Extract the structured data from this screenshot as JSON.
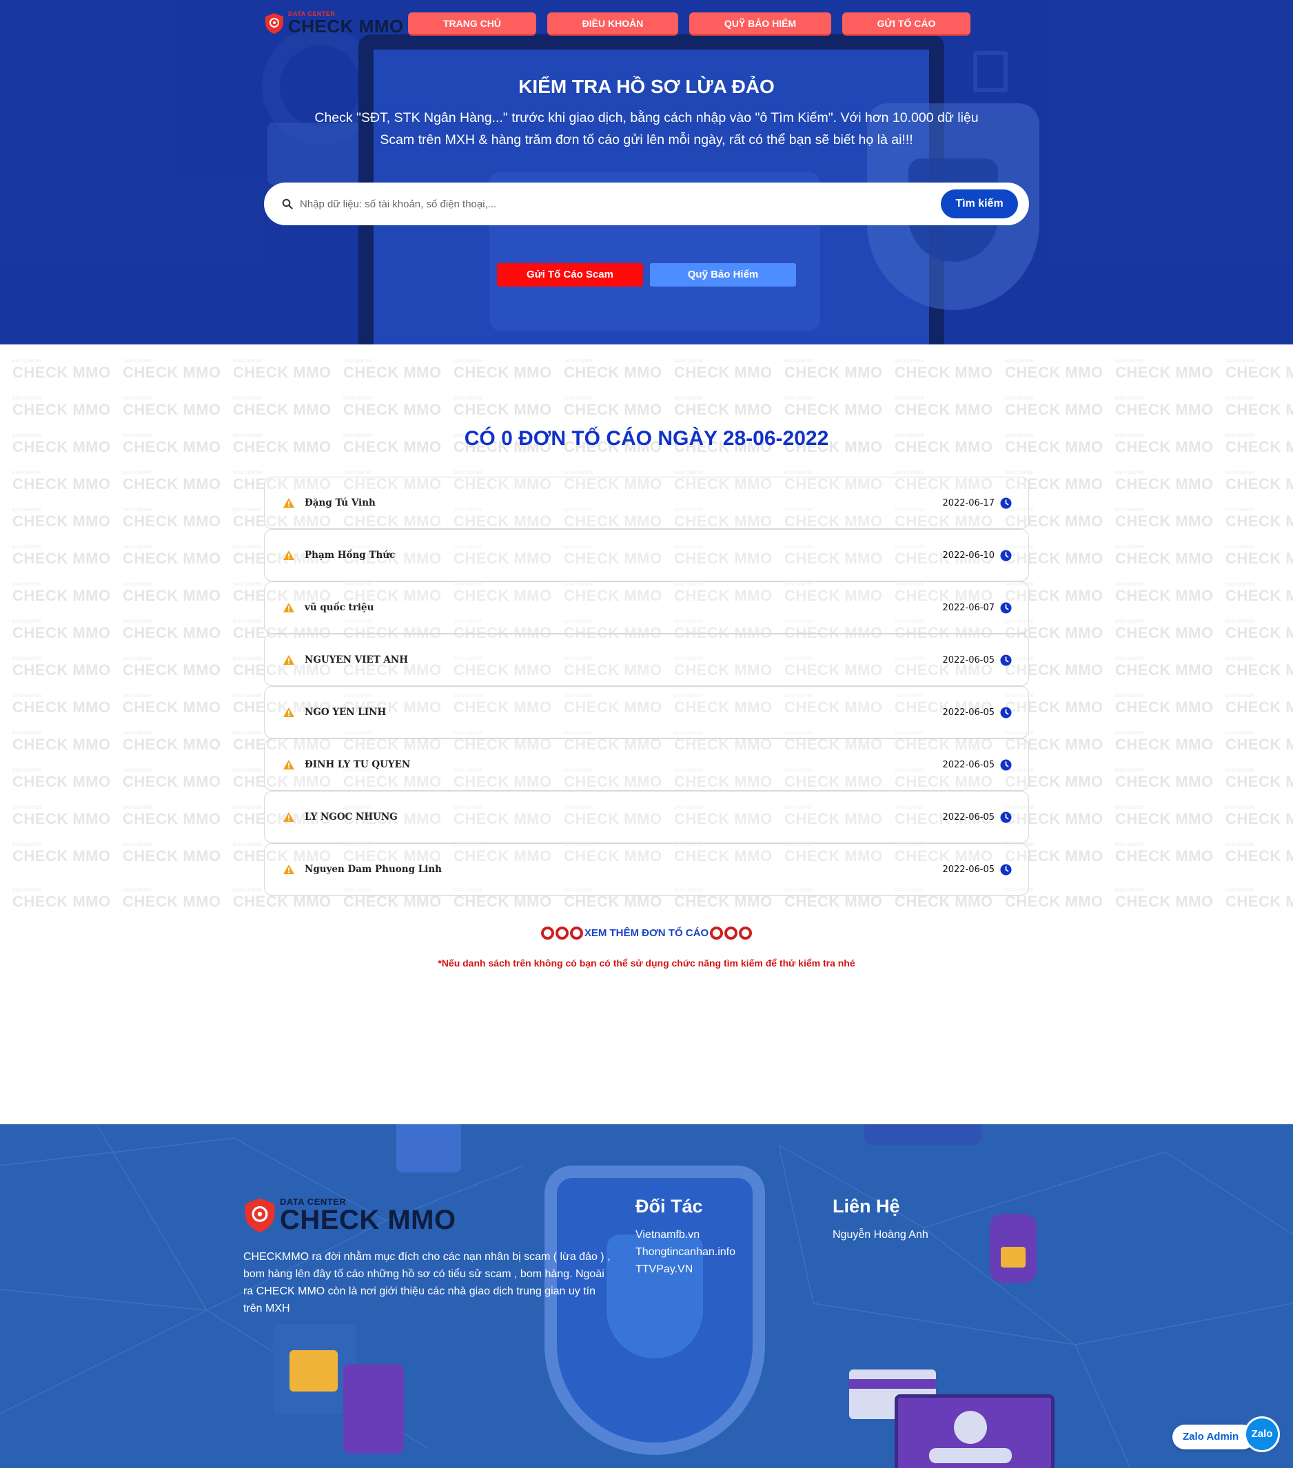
{
  "brand": {
    "logo_small": "DATA CENTER",
    "logo_big": "CHECK MMO"
  },
  "nav": [
    "TRANG CHỦ",
    "ĐIỀU KHOẢN",
    "QUỸ BẢO HIỂM",
    "GỬI TỐ CÁO"
  ],
  "hero": {
    "title": "KIỂM TRA HỒ SƠ LỪA ĐẢO",
    "desc_line1": "Check \"SĐT, STK Ngân Hàng...\" trước khi giao dịch, bằng cách nhập vào \"ô Tìm Kiếm\". Với hơn 10.000 dữ liệu",
    "desc_line2": "Scam trên MXH & hàng trăm đơn tố cáo gửi lên mỗi ngày, rất có thể bạn sẽ biết họ là ai!!!",
    "search_placeholder": "Nhập dữ liệu: số tài khoản, số điện thoại,...",
    "search_value": "",
    "search_button": "Tìm kiếm",
    "cta_report": "Gửi Tố Cáo Scam",
    "cta_fund": "Quỹ Bảo Hiểm"
  },
  "main": {
    "title": "CÓ 0 ĐƠN TỐ CÁO NGÀY 28-06-2022",
    "reports": [
      {
        "name": "Đặng Tú Vinh",
        "date": "2022-06-17"
      },
      {
        "name": "Phạm Hồng Thức",
        "date": "2022-06-10"
      },
      {
        "name": "vũ quốc triệu",
        "date": "2022-06-07"
      },
      {
        "name": "NGUYEN VIET ANH",
        "date": "2022-06-05"
      },
      {
        "name": "NGO YEN LINH",
        "date": "2022-06-05"
      },
      {
        "name": "ĐINH LY TU QUYEN",
        "date": "2022-06-05"
      },
      {
        "name": "LY NGOC NHUNG",
        "date": "2022-06-05"
      },
      {
        "name": "Nguyen Dam Phuong Linh",
        "date": "2022-06-05"
      }
    ],
    "more_label": "XEM THÊM ĐƠN TỐ CÁO",
    "note": "*Nếu danh sách trên không có bạn có thể sử dụng chức năng tìm kiếm để thử kiểm tra nhé",
    "watermark_small": "DATA CENTER",
    "watermark_big": "CHECK MMO"
  },
  "footer": {
    "logo_small": "DATA CENTER",
    "logo_big": "CHECK MMO",
    "about": "CHECKMMO ra đời nhằm mục đích cho các nạn nhân bị scam ( lừa đảo ) , bom hàng lên đây tố cáo những hồ sơ có tiểu sử scam , bom hàng. Ngoài ra CHECK MMO còn là nơi giới thiệu các nhà giao dịch trung gian uy tín trên MXH",
    "partners_title": "Đối Tác",
    "partners": [
      "Vietnamfb.vn",
      "Thongtincanhan.info",
      "TTVPay.VN"
    ],
    "contact_title": "Liên Hệ",
    "contacts": [
      "Nguyễn Hoàng Anh"
    ]
  },
  "zalo": {
    "label": "Zalo Admin",
    "icon_text": "Zalo"
  },
  "colors": {
    "hero_bg": "#1a3a9e",
    "nav_btn": "#ff5e5e",
    "search_btn": "#0d47c8",
    "cta_red": "#ff0a0a",
    "cta_blue": "#4d8dff",
    "main_title": "#1032c8",
    "warn_icon": "#f0a019",
    "clock_icon": "#1032c8",
    "note_red": "#d41414",
    "footer_bg": "#2a61b3"
  },
  "icons": {
    "search": "search-icon",
    "warn": "warning-triangle-icon",
    "clock": "clock-icon",
    "logo": "shield-logo-icon",
    "ring": "ring-icon"
  }
}
